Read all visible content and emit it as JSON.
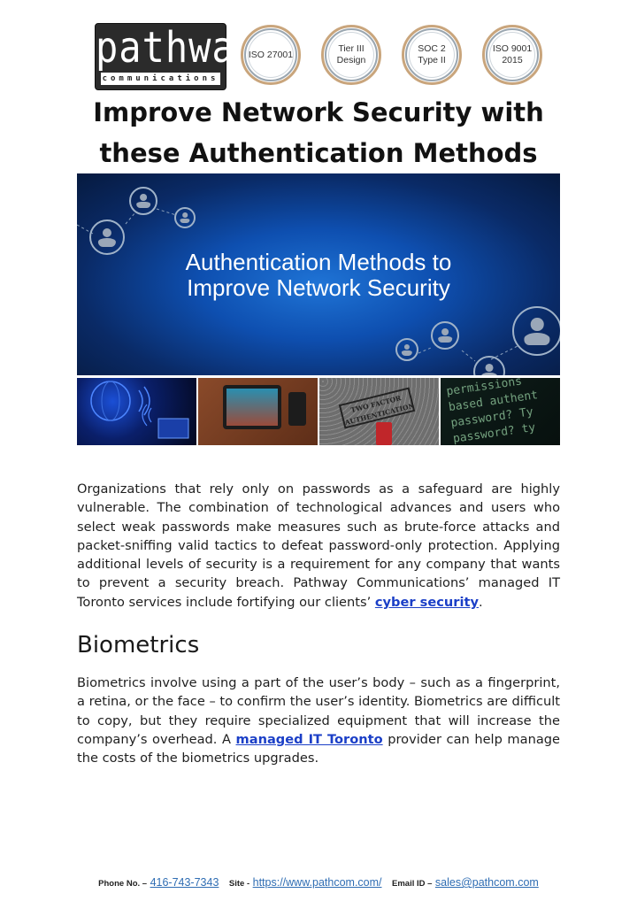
{
  "header": {
    "logo": {
      "word": "pathway",
      "sub": "communications"
    },
    "badges": [
      {
        "line1": "ISO 27001",
        "line2": ""
      },
      {
        "line1": "Tier III",
        "line2": "Design"
      },
      {
        "line1": "SOC 2",
        "line2": "Type II"
      },
      {
        "line1": "ISO 9001",
        "line2": "2015"
      }
    ],
    "colors": {
      "badge_ring": "#c9a57c",
      "logo_bg": "#2b2b2b"
    }
  },
  "title": {
    "line1": "Improve Network Security with",
    "line2": "these Authentication Methods"
  },
  "hero": {
    "title_line1": "Authentication Methods to",
    "title_line2": "Improve Network Security",
    "tiles": [
      {
        "name": "network-globe",
        "text": ""
      },
      {
        "name": "login-tablet",
        "text": ""
      },
      {
        "name": "two-factor",
        "text": "TWO FACTOR AUTHENTICATION"
      },
      {
        "name": "password-code",
        "text": "permissions\nbased authent\npassword? Ty\npassword? ty"
      }
    ]
  },
  "intro": {
    "text_before_link": "Organizations that rely only on passwords as a safeguard are highly vulnerable. The combination of technological advances and users who select weak passwords make measures such as brute-force attacks and packet-sniffing valid tactics to defeat password-only protection. Applying additional levels of security is a requirement for any company that wants to prevent a security breach. Pathway Communications’ managed IT Toronto services include fortifying our clients’ ",
    "link_text": "cyber security",
    "text_after_link": "."
  },
  "biometrics": {
    "heading": "Biometrics",
    "text_before_link": "Biometrics involve using a part of the user’s body – such as a fingerprint, a retina, or the face – to confirm the user’s identity. Biometrics are difficult to copy, but they require specialized equipment that will increase the company’s overhead. A ",
    "link_text": "managed IT Toronto",
    "text_after_link": " provider can help manage the costs of the biometrics upgrades."
  },
  "footer": {
    "phone_label": "Phone No. –",
    "phone": "416-743-7343",
    "site_label": "Site -",
    "site": "https://www.pathcom.com/",
    "email_label": "Email ID –",
    "email": "sales@pathcom.com"
  },
  "colors": {
    "link": "#1b3fc7",
    "footer_link": "#2f6db3"
  }
}
